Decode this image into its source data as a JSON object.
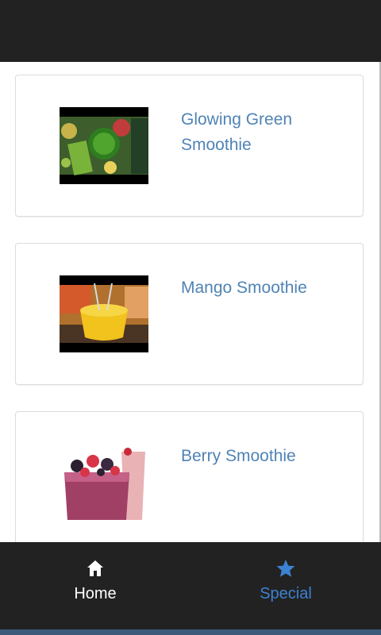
{
  "colors": {
    "bar_bg": "#222222",
    "title_link": "#4f83b5",
    "home_label": "#ffffff",
    "special_label": "#3c82d2"
  },
  "items": [
    {
      "title": "Glowing Green Smoothie",
      "thumb_icon": "green-smoothie-photo"
    },
    {
      "title": "Mango Smoothie",
      "thumb_icon": "mango-smoothie-photo"
    },
    {
      "title": "Berry Smoothie",
      "thumb_icon": "berry-smoothie-photo"
    }
  ],
  "nav": {
    "home": {
      "label": "Home",
      "icon": "home-icon"
    },
    "special": {
      "label": "Special",
      "icon": "star-icon"
    }
  }
}
